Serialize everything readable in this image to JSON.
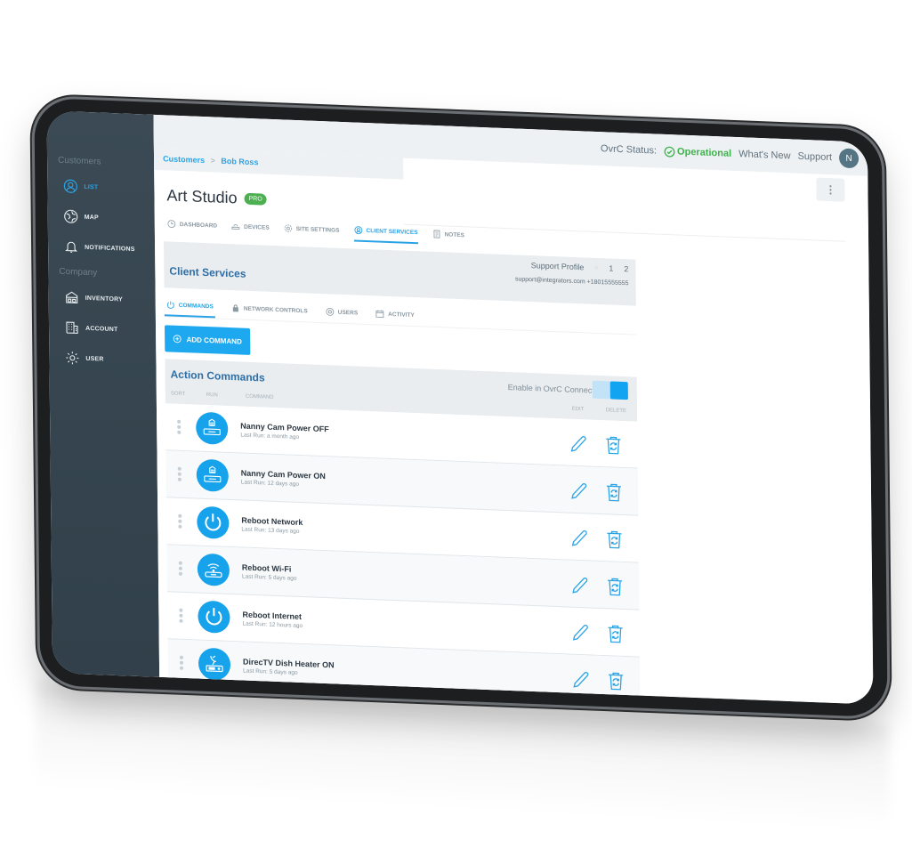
{
  "topbar": {
    "status_label": "OvrC Status:",
    "status_value": "Operational",
    "whats_new": "What's New",
    "support": "Support",
    "avatar_initial": "N"
  },
  "sidebar": {
    "sections": [
      {
        "label": "Customers",
        "items": [
          {
            "label": "LIST",
            "icon": "user-circle-icon",
            "active": true
          },
          {
            "label": "MAP",
            "icon": "globe-icon"
          },
          {
            "label": "NOTIFICATIONS",
            "icon": "bell-icon"
          }
        ]
      },
      {
        "label": "Company",
        "items": [
          {
            "label": "INVENTORY",
            "icon": "warehouse-icon"
          },
          {
            "label": "ACCOUNT",
            "icon": "building-icon"
          },
          {
            "label": "USER",
            "icon": "gear-icon"
          }
        ]
      }
    ]
  },
  "breadcrumb": {
    "root": "Customers",
    "separator": ">",
    "current": "Bob Ross"
  },
  "site": {
    "title": "Art Studio",
    "badge": "PRO"
  },
  "tabs": [
    {
      "label": "DASHBOARD",
      "icon": "clock-icon"
    },
    {
      "label": "DEVICES",
      "icon": "router-icon"
    },
    {
      "label": "SITE SETTINGS",
      "icon": "gear-icon"
    },
    {
      "label": "CLIENT SERVICES",
      "icon": "support-icon",
      "active": true
    },
    {
      "label": "NOTES",
      "icon": "notes-icon"
    }
  ],
  "client_services": {
    "title": "Client Services",
    "support_profile_label": "Support Profile",
    "profile_options": [
      "1",
      "2"
    ],
    "contact": "support@integrators.com +18015555555"
  },
  "subtabs": [
    {
      "label": "COMMANDS",
      "icon": "power-icon",
      "active": true
    },
    {
      "label": "NETWORK CONTROLS",
      "icon": "lock-icon"
    },
    {
      "label": "USERS",
      "icon": "at-icon"
    },
    {
      "label": "ACTIVITY",
      "icon": "calendar-icon"
    }
  ],
  "add_command_label": "ADD COMMAND",
  "action_commands": {
    "title": "Action Commands",
    "enable_label": "Enable in OvrC Connect",
    "enabled": true,
    "columns": {
      "sort": "SORT",
      "run": "RUN",
      "command": "COMMAND",
      "edit": "EDIT",
      "delete": "DELETE"
    },
    "rows": [
      {
        "name": "Nanny Cam Power OFF",
        "last_run": "Last Run: a month ago",
        "icon": "power-strip-icon"
      },
      {
        "name": "Nanny Cam Power ON",
        "last_run": "Last Run: 12 days ago",
        "icon": "power-strip-icon"
      },
      {
        "name": "Reboot Network",
        "last_run": "Last Run: 13 days ago",
        "icon": "power-icon"
      },
      {
        "name": "Reboot Wi-Fi",
        "last_run": "Last Run: 5 days ago",
        "icon": "wifi-router-icon"
      },
      {
        "name": "Reboot Internet",
        "last_run": "Last Run: 12 hours ago",
        "icon": "power-icon"
      },
      {
        "name": "DirecTV Dish Heater ON",
        "last_run": "Last Run: 5 days ago",
        "icon": "satellite-receiver-icon"
      }
    ]
  },
  "colors": {
    "accent": "#1ea8ef",
    "sidebar": "#34434d",
    "status_ok": "#3bb34a",
    "section_title": "#2e6ea7"
  }
}
